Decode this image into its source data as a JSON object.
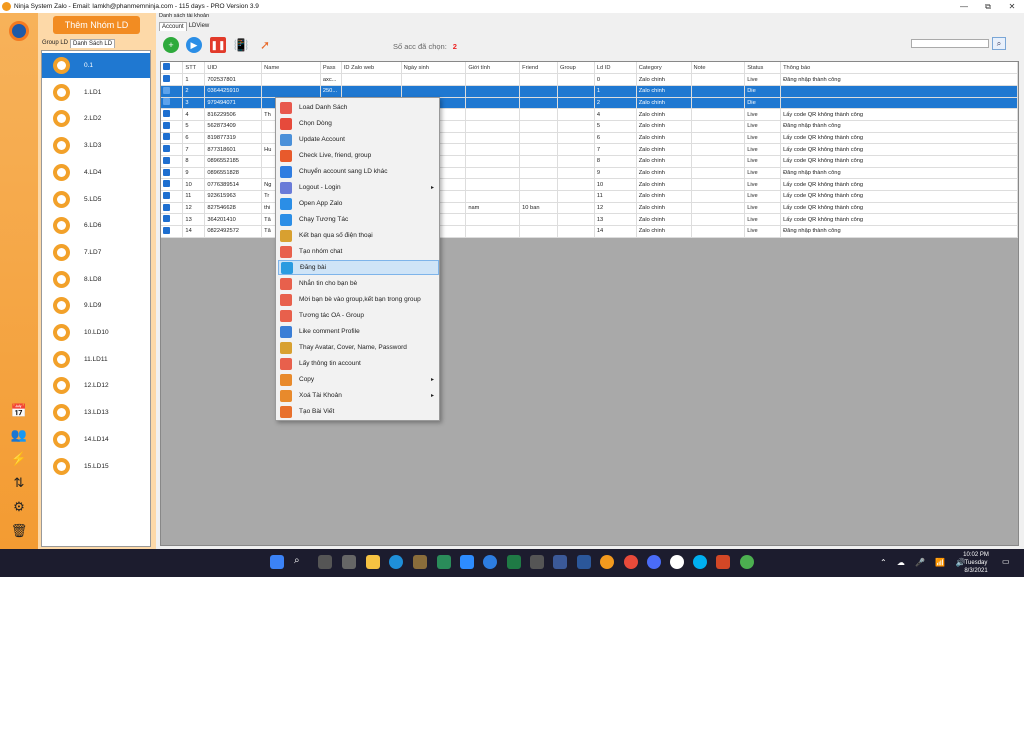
{
  "window": {
    "title": "Ninja System Zalo - Email: lamkh@phanmemninja.com - 115 days - PRO Version 3.9",
    "controls": [
      "—",
      "⧉",
      "✕"
    ]
  },
  "sidebar": {
    "add_button": "Thêm Nhóm LD",
    "tabs": [
      "Group LD",
      "Danh Sách LD"
    ],
    "groups": [
      "0.1",
      "1.LD1",
      "2.LD2",
      "3.LD3",
      "4.LD4",
      "5.LD5",
      "6.LD6",
      "7.LD7",
      "8.LD8",
      "9.LD9",
      "10.LD10",
      "11.LD11",
      "12.LD12",
      "13.LD13",
      "14.LD14",
      "15.LD15"
    ],
    "selected_group": "0.1"
  },
  "main": {
    "section_label": "Danh sách tài khoản",
    "tabs": [
      "Account",
      "LDView"
    ],
    "selected_label": "Số acc đã chọn:",
    "selected_count": "2"
  },
  "table": {
    "columns": [
      "",
      "STT",
      "UID",
      "Name",
      "Pass",
      "ID Zalo web",
      "Ngày sinh",
      "Giới tính",
      "Friend",
      "Group",
      "Ld ID",
      "Category",
      "Note",
      "Status",
      "Thông báo"
    ],
    "rows": [
      [
        "",
        "1",
        "702537801",
        "",
        "axc...",
        "",
        "",
        "",
        "",
        "",
        "0",
        "Zalo chinh",
        "",
        "Live",
        "Đăng nhập thành công"
      ],
      [
        "",
        "2",
        "0364425910",
        "",
        "250...",
        "",
        "",
        "",
        "",
        "",
        "1",
        "Zalo chinh",
        "",
        "Die",
        ""
      ],
      [
        "",
        "3",
        "979494071",
        "",
        "",
        "",
        "",
        "",
        "",
        "",
        "2",
        "Zalo chinh",
        "",
        "Die",
        ""
      ],
      [
        "",
        "4",
        "816229506",
        "Th",
        "",
        "",
        "",
        "",
        "",
        "",
        "4",
        "Zalo chinh",
        "",
        "Live",
        "Lấy code QR không thành công"
      ],
      [
        "",
        "5",
        "562873409",
        "",
        "",
        "",
        "",
        "",
        "",
        "",
        "5",
        "Zalo chinh",
        "",
        "Live",
        "Đăng nhập thành công"
      ],
      [
        "",
        "6",
        "819877319",
        "",
        "",
        "",
        "",
        "",
        "",
        "",
        "6",
        "Zalo chinh",
        "",
        "Live",
        "Lấy code QR không thành công"
      ],
      [
        "",
        "7",
        "877318601",
        "Hu",
        "",
        "",
        "",
        "",
        "",
        "",
        "7",
        "Zalo chinh",
        "",
        "Live",
        "Lấy code QR không thành công"
      ],
      [
        "",
        "8",
        "0896552185",
        "",
        "",
        "",
        "",
        "",
        "",
        "",
        "8",
        "Zalo chinh",
        "",
        "Live",
        "Lấy code QR không thành công"
      ],
      [
        "",
        "9",
        "0896551828",
        "",
        "",
        "",
        "",
        "",
        "",
        "",
        "9",
        "Zalo chinh",
        "",
        "Live",
        "Đăng nhập thành công"
      ],
      [
        "",
        "10",
        "0776389514",
        "Ng",
        "",
        "",
        "",
        "",
        "",
        "",
        "10",
        "Zalo chinh",
        "",
        "Live",
        "Lấy code QR không thành công"
      ],
      [
        "",
        "11",
        "923615963",
        "Tr",
        "",
        "",
        "",
        "",
        "",
        "",
        "11",
        "Zalo chinh",
        "",
        "Live",
        "Lấy code QR không thành công"
      ],
      [
        "",
        "12",
        "827546628",
        "thi",
        "",
        "",
        "1995",
        "nam",
        "10 ban",
        "",
        "12",
        "Zalo chinh",
        "",
        "Live",
        "Lấy code QR không thành công"
      ],
      [
        "",
        "13",
        "364201410",
        "Tâ",
        "",
        "",
        "",
        "",
        "",
        "",
        "13",
        "Zalo chinh",
        "",
        "Live",
        "Lấy code QR không thành công"
      ],
      [
        "",
        "14",
        "0822492572",
        "Tâ",
        "",
        "",
        "",
        "",
        "",
        "",
        "14",
        "Zalo chinh",
        "",
        "Live",
        "Đăng nhập thành công"
      ]
    ],
    "selected_rows": [
      1,
      2
    ]
  },
  "context_menu": {
    "items": [
      {
        "label": "Load Danh Sách",
        "icon": "refresh-icon",
        "color": "#e8584d",
        "submenu": false
      },
      {
        "label": "Chọn Dòng",
        "icon": "check-icon",
        "color": "#e64a3b",
        "submenu": false
      },
      {
        "label": "Update Account",
        "icon": "document-icon",
        "color": "#4a90d9",
        "submenu": false
      },
      {
        "label": "Check Live, friend, group",
        "icon": "checklist-icon",
        "color": "#e85a2c",
        "submenu": false
      },
      {
        "label": "Chuyển account sang LD khác",
        "icon": "transfer-icon",
        "color": "#2f7de1",
        "submenu": false
      },
      {
        "label": "Logout - Login",
        "icon": "logout-icon",
        "color": "#6a7bd8",
        "submenu": true
      },
      {
        "label": "Open App Zalo",
        "icon": "zalo-icon",
        "color": "#2b8ee6",
        "submenu": false
      },
      {
        "label": "Chạy Tương Tác",
        "icon": "play-icon",
        "color": "#2b8ee6",
        "submenu": false
      },
      {
        "label": "Kết bạn qua số điện thoại",
        "icon": "add-friend-icon",
        "color": "#d8a030",
        "submenu": false
      },
      {
        "label": "Tạo nhóm chat",
        "icon": "group-icon",
        "color": "#e8604c",
        "submenu": false
      },
      {
        "label": "Đăng bài",
        "icon": "telegram-icon",
        "color": "#2b9be0",
        "submenu": false
      },
      {
        "label": "Nhắn tin cho bạn bè",
        "icon": "message-icon",
        "color": "#e8604c",
        "submenu": false
      },
      {
        "label": "Mời bạn bè vào group,kết bạn trong group",
        "icon": "invite-icon",
        "color": "#e8604c",
        "submenu": false
      },
      {
        "label": "Tương tác OA - Group",
        "icon": "group-icon",
        "color": "#e8604c",
        "submenu": false
      },
      {
        "label": "Like comment Profile",
        "icon": "profile-icon",
        "color": "#3a7ed6",
        "submenu": false
      },
      {
        "label": "Thay Avatar, Cover, Name, Password",
        "icon": "users-icon",
        "color": "#d8a030",
        "submenu": false
      },
      {
        "label": "Lấy thông tin account",
        "icon": "info-icon",
        "color": "#e8604c",
        "submenu": false
      },
      {
        "label": "Copy",
        "icon": "copy-icon",
        "color": "#e88a2c",
        "submenu": true
      },
      {
        "label": "Xoá Tài Khoản",
        "icon": "delete-icon",
        "color": "#e88a2c",
        "submenu": true
      },
      {
        "label": "Tạo Bài Viết",
        "icon": "post-icon",
        "color": "#e8702c",
        "submenu": false
      }
    ],
    "hovered": "Đăng bài"
  },
  "taskbar": {
    "time": "10:02 PM",
    "day": "Tuesday",
    "date": "8/3/2021"
  },
  "colors": {
    "accent_orange": "#f28c22",
    "selection_blue": "#1f78d1",
    "danger_red": "#e22"
  }
}
